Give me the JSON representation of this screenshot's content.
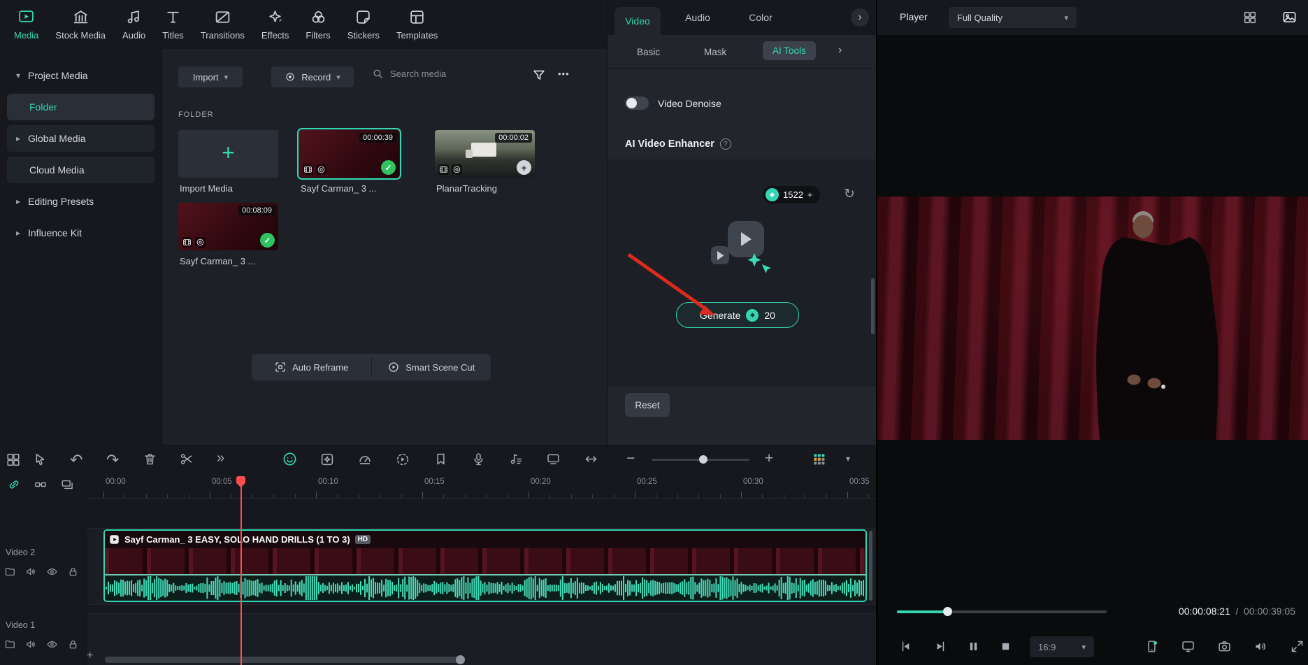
{
  "glyphs": {
    "plus": "+",
    "minus": "−",
    "ellipsis": "•••",
    "more": "»",
    "caret_down": "▾",
    "caret_right": "▸",
    "chevron_right": "›",
    "question": "?",
    "refresh": "↻",
    "diamond": "◆",
    "check": "✓",
    "undo": "↶",
    "redo": "↷",
    "slash": "/"
  },
  "top_nav": {
    "items": [
      {
        "label": "Media"
      },
      {
        "label": "Stock Media"
      },
      {
        "label": "Audio"
      },
      {
        "label": "Titles"
      },
      {
        "label": "Transitions"
      },
      {
        "label": "Effects"
      },
      {
        "label": "Filters"
      },
      {
        "label": "Stickers"
      },
      {
        "label": "Templates"
      }
    ]
  },
  "sidebar": {
    "items": [
      {
        "label": "Project Media"
      },
      {
        "label": "Folder"
      },
      {
        "label": "Global Media"
      },
      {
        "label": "Cloud Media"
      },
      {
        "label": "Editing Presets"
      },
      {
        "label": "Influence Kit"
      }
    ]
  },
  "media_panel": {
    "import_button": "Import",
    "record_button": "Record",
    "search_placeholder": "Search media",
    "section_label": "FOLDER",
    "items": [
      {
        "label": "Import Media"
      },
      {
        "label": "Sayf Carman_ 3 ...",
        "duration": "00:00:39"
      },
      {
        "label": "PlanarTracking",
        "duration": "00:00:02"
      },
      {
        "label": "Sayf Carman_ 3 ...",
        "duration": "00:08:09"
      }
    ],
    "footer": {
      "auto_reframe": "Auto Reframe",
      "smart_scene_cut": "Smart Scene Cut"
    }
  },
  "properties_panel": {
    "tabs": [
      {
        "label": "Video"
      },
      {
        "label": "Audio"
      },
      {
        "label": "Color"
      }
    ],
    "subtabs": [
      {
        "label": "Basic"
      },
      {
        "label": "Mask"
      },
      {
        "label": "AI Tools"
      }
    ],
    "denoise_label": "Video Denoise",
    "enhancer_title": "AI Video Enhancer",
    "credits": "1522",
    "generate_label": "Generate",
    "generate_cost": "20",
    "reset_label": "Reset"
  },
  "player": {
    "title": "Player",
    "quality": "Full Quality",
    "elapsed": "00:00:08:21",
    "total": "00:00:39:05",
    "aspect": "16:9"
  },
  "timeline": {
    "ruler_labels": [
      "00:00",
      "00:05",
      "00:10",
      "00:15",
      "00:20",
      "00:25",
      "00:30",
      "00:35"
    ],
    "tracks": [
      {
        "label": "Video 2"
      },
      {
        "label": "Video 1"
      }
    ],
    "clip": {
      "title": "Sayf Carman_ 3 EASY, SOLO HAND DRILLS (1 TO 3)",
      "badge": "HD"
    }
  }
}
